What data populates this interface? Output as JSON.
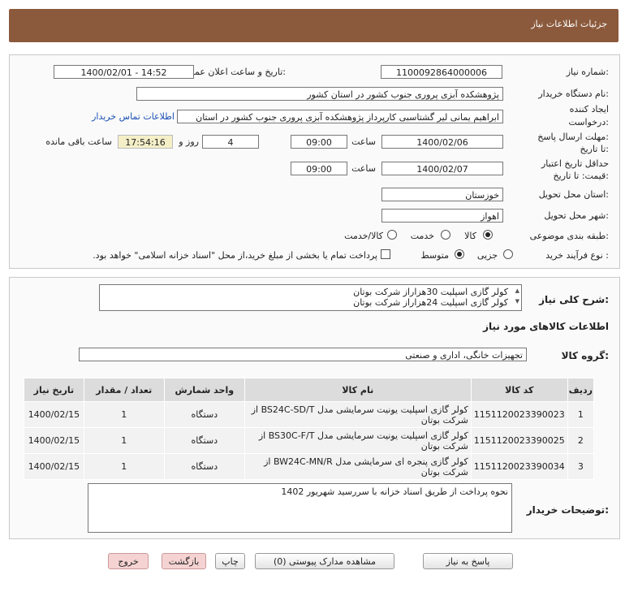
{
  "header": {
    "title": "جزئیات اطلاعات نیاز"
  },
  "fields": {
    "need_number_label": "شماره نیاز:",
    "need_number": "1100092864000006",
    "announce_label": "تاریخ و ساعت اعلان عمومی:",
    "announce_value": "1400/02/01 - 14:52",
    "buyer_label": "نام دستگاه خریدار:",
    "buyer_value": "پژوهشکده آبزی پروری جنوب کشور در استان کشور",
    "creator_label1": "ایجاد کننده",
    "creator_label2": "درخواست:",
    "creator_value": "ابراهیم یمانی لیر گشتاسبی کارپرداز پژوهشکده آبزی پروری جنوب کشور در استان",
    "contact_link": "اطلاعات تماس خریدار",
    "deadline_label1": "مهلت ارسال پاسخ:",
    "deadline_label2": "تا تاریخ:",
    "deadline_date": "1400/02/06",
    "time_label": "ساعت",
    "deadline_time": "09:00",
    "days_value": "4",
    "days_label": "روز و",
    "remaining_time": "17:54:16",
    "remaining_label": "ساعت باقی مانده",
    "validity_label1": "حداقل تاریخ اعتبار",
    "validity_label2": "قیمت: تا تاریخ:",
    "validity_date": "1400/02/07",
    "validity_time": "09:00",
    "province_label": "استان محل تحویل:",
    "province_value": "خوزستان",
    "city_label": "شهر محل تحویل:",
    "city_value": "اهواز",
    "category_label": "طبقه بندی موضوعی:",
    "category_options": [
      "کالا",
      "خدمت",
      "کالا/خدمت"
    ],
    "purchase_label": "نوع فرآیند خرید :",
    "purchase_options": [
      "جزیی",
      "متوسط"
    ],
    "purchase_note": "پرداخت تمام یا بخشی از مبلغ خرید،از محل \"اسناد خزانه اسلامی\" خواهد بود."
  },
  "summary": {
    "label": "شرح کلی نیاز:",
    "lines": [
      "کولر گازی اسپلیت  30هزاراز شرکت بوتان",
      "کولر گازی اسپلیت 24هزاراز شرکت بوتان"
    ]
  },
  "goods": {
    "section_title": "اطلاعات کالاهای مورد نیاز",
    "group_label": "گروه کالا:",
    "group_value": "تجهیزات خانگی، اداری و صنعتی",
    "columns": [
      "ردیف",
      "کد کالا",
      "نام کالا",
      "واحد شمارش",
      "تعداد / مقدار",
      "تاریخ نیاز"
    ],
    "rows": [
      {
        "row": "1",
        "code": "1151120023390023",
        "name": "کولر گازی اسپلیت یونیت سرمایشی مدل BS24C-SD/T از شرکت بوتان",
        "unit": "دستگاه",
        "qty": "1",
        "date": "1400/02/15"
      },
      {
        "row": "2",
        "code": "1151120023390025",
        "name": "کولر گازی اسپلیت یونیت سرمایشی مدل BS30C-F/T از شرکت بوتان",
        "unit": "دستگاه",
        "qty": "1",
        "date": "1400/02/15"
      },
      {
        "row": "3",
        "code": "1151120023390034",
        "name": "کولر گازی پنجره ای سرمایشی مدل BW24C-MN/R از شرکت بوتان",
        "unit": "دستگاه",
        "qty": "1",
        "date": "1400/02/15"
      }
    ]
  },
  "buyer_notes": {
    "label": "توضیحات خریدار:",
    "text": "نحوه پرداخت از طریق اسناد خزانه با سررسید شهریور 1402"
  },
  "buttons": {
    "reply": "پاسخ به نیاز",
    "docs": "مشاهده مدارک پیوستی (0)",
    "print": "چاپ",
    "back": "بازگشت",
    "exit": "خروج"
  }
}
